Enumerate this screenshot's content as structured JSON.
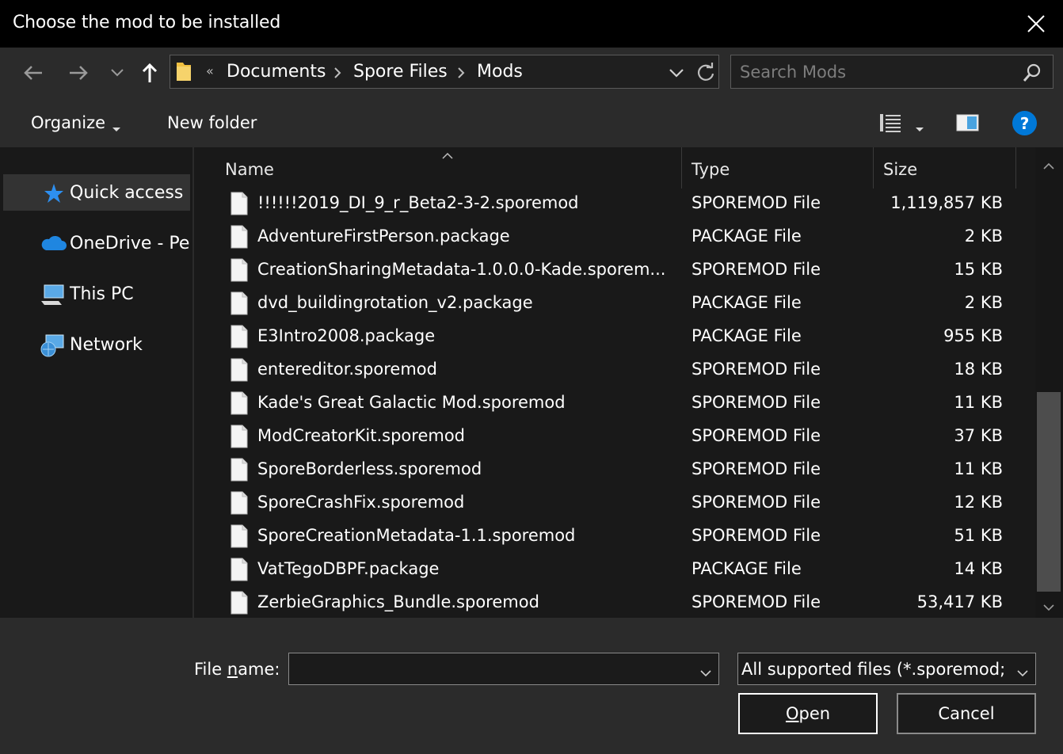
{
  "window": {
    "title": "Choose the mod to be installed"
  },
  "icons": {
    "close": "close-icon",
    "back": "back-arrow-icon",
    "forward": "forward-arrow-icon",
    "recent": "chevron-down-icon",
    "up": "up-arrow-icon",
    "folder": "folder-icon",
    "refresh": "refresh-icon",
    "search": "search-icon",
    "view": "details-view-icon",
    "preview": "preview-pane-icon",
    "help": "help-icon"
  },
  "address": {
    "overflow": "«",
    "breadcrumbs": [
      "Documents",
      "Spore Files",
      "Mods"
    ]
  },
  "search": {
    "placeholder": "Search Mods"
  },
  "toolbar": {
    "organize": "Organize",
    "new_folder": "New folder",
    "help": "?"
  },
  "sidebar": {
    "items": [
      {
        "label": "Quick access",
        "icon": "star-icon",
        "selected": true
      },
      {
        "label": "OneDrive - Per",
        "icon": "cloud-icon",
        "selected": false
      },
      {
        "label": "This PC",
        "icon": "computer-icon",
        "selected": false
      },
      {
        "label": "Network",
        "icon": "network-icon",
        "selected": false
      }
    ]
  },
  "columns": {
    "name": "Name",
    "type": "Type",
    "size": "Size"
  },
  "files": [
    {
      "name": "!!!!!!2019_DI_9_r_Beta2-3-2.sporemod",
      "type": "SPOREMOD File",
      "size": "1,119,857 KB"
    },
    {
      "name": "AdventureFirstPerson.package",
      "type": "PACKAGE File",
      "size": "2 KB"
    },
    {
      "name": "CreationSharingMetadata-1.0.0.0-Kade.sporem...",
      "type": "SPOREMOD File",
      "size": "15 KB"
    },
    {
      "name": "dvd_buildingrotation_v2.package",
      "type": "PACKAGE File",
      "size": "2 KB"
    },
    {
      "name": "E3Intro2008.package",
      "type": "PACKAGE File",
      "size": "955 KB"
    },
    {
      "name": "entereditor.sporemod",
      "type": "SPOREMOD File",
      "size": "18 KB"
    },
    {
      "name": "Kade's Great Galactic Mod.sporemod",
      "type": "SPOREMOD File",
      "size": "11 KB"
    },
    {
      "name": "ModCreatorKit.sporemod",
      "type": "SPOREMOD File",
      "size": "37 KB"
    },
    {
      "name": "SporeBorderless.sporemod",
      "type": "SPOREMOD File",
      "size": "11 KB"
    },
    {
      "name": "SporeCrashFix.sporemod",
      "type": "SPOREMOD File",
      "size": "12 KB"
    },
    {
      "name": "SporeCreationMetadata-1.1.sporemod",
      "type": "SPOREMOD File",
      "size": "51 KB"
    },
    {
      "name": "VatTegoDBPF.package",
      "type": "PACKAGE File",
      "size": "14 KB"
    },
    {
      "name": "ZerbieGraphics_Bundle.sporemod",
      "type": "SPOREMOD File",
      "size": "53,417 KB"
    }
  ],
  "footer": {
    "filename_label_pre": "File ",
    "filename_label_accel": "n",
    "filename_label_post": "ame:",
    "filename_value": "",
    "filetype": "All supported files (*.sporemod;",
    "open_accel": "O",
    "open_rest": "pen",
    "cancel": "Cancel"
  },
  "colors": {
    "accent": "#0078d7",
    "background": "#191919",
    "bar": "#2b2b2b"
  }
}
